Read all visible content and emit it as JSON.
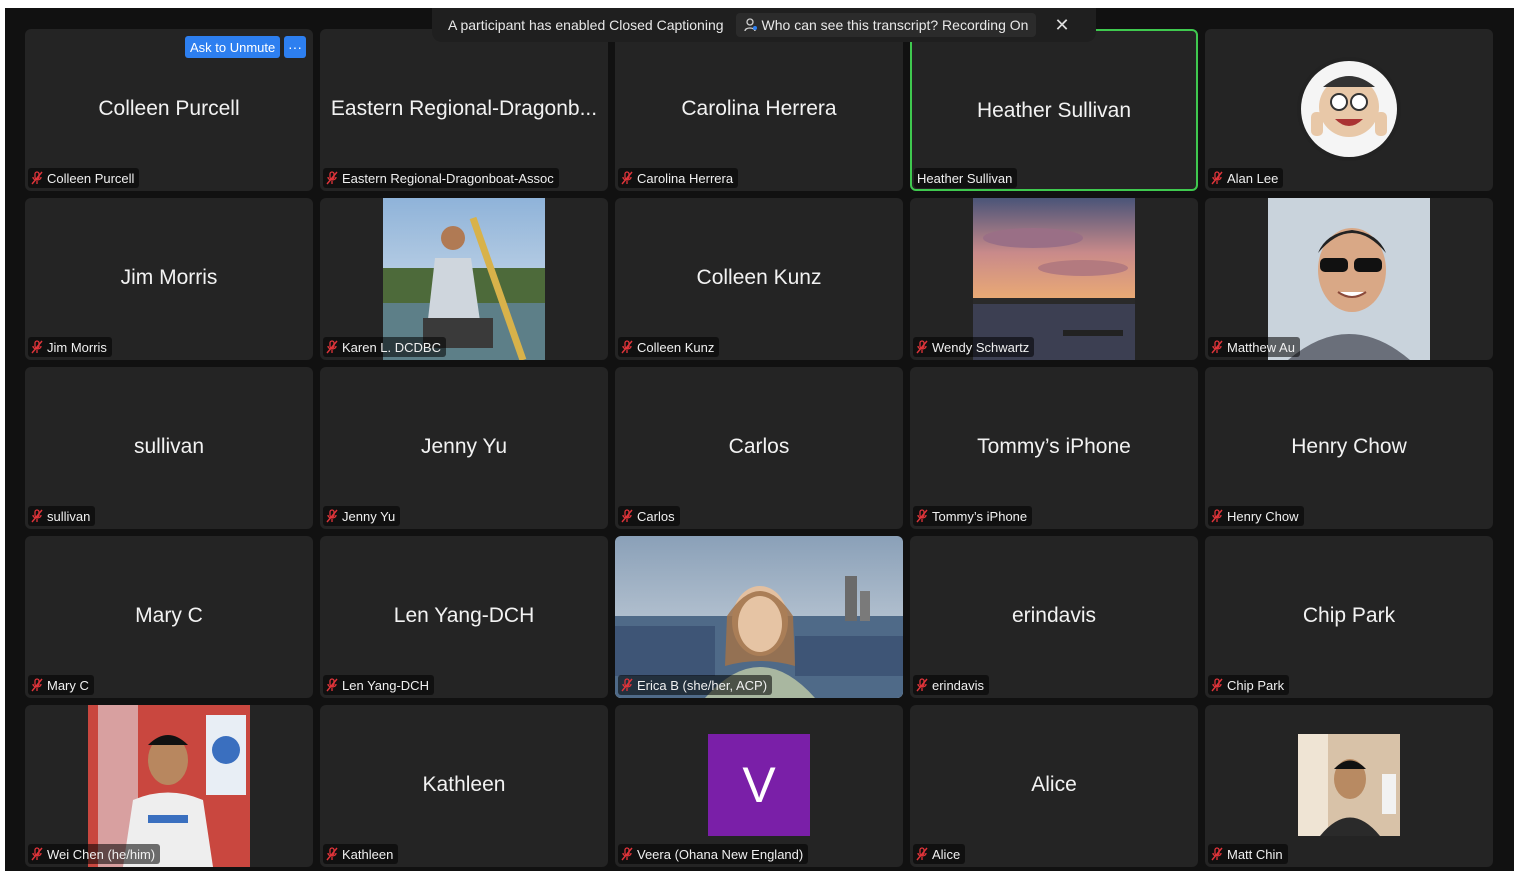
{
  "banner": {
    "cc_text": "A participant has enabled Closed Captioning",
    "who_text": "Who can see this transcript? Recording On",
    "close_label": "✕"
  },
  "host_controls": {
    "ask_unmute": "Ask to Unmute",
    "more": "···"
  },
  "participants": [
    {
      "display": "Colleen Purcell",
      "label": "Colleen Purcell",
      "video": "none"
    },
    {
      "display": "Eastern Regional-Dragonb...",
      "label": "Eastern Regional-Dragonboat-Assoc",
      "video": "none"
    },
    {
      "display": "Carolina Herrera",
      "label": "Carolina Herrera",
      "video": "none"
    },
    {
      "display": "Heather Sullivan",
      "label": "Heather Sullivan",
      "video": "none",
      "speaking": true
    },
    {
      "display": "",
      "label": "Alan Lee",
      "video": "avatar"
    },
    {
      "display": "Jim Morris",
      "label": "Jim Morris",
      "video": "none"
    },
    {
      "display": "",
      "label": "Karen  L. DCDBC",
      "video": "paddler-photo"
    },
    {
      "display": "Colleen Kunz",
      "label": "Colleen Kunz",
      "video": "none"
    },
    {
      "display": "",
      "label": "Wendy Schwartz",
      "video": "sunset-photo"
    },
    {
      "display": "",
      "label": "Matthew Au",
      "video": "portrait-photo"
    },
    {
      "display": "sullivan",
      "label": "sullivan",
      "video": "none"
    },
    {
      "display": "Jenny Yu",
      "label": "Jenny Yu",
      "video": "none"
    },
    {
      "display": "Carlos",
      "label": "Carlos",
      "video": "none"
    },
    {
      "display": "Tommy’s iPhone",
      "label": "Tommy’s iPhone",
      "video": "none"
    },
    {
      "display": "Henry Chow",
      "label": "Henry Chow",
      "video": "none"
    },
    {
      "display": "Mary C",
      "label": "Mary C",
      "video": "none"
    },
    {
      "display": "Len Yang-DCH",
      "label": "Len Yang-DCH",
      "video": "none"
    },
    {
      "display": "",
      "label": "Erica B (she/her, ACP)",
      "video": "live-video"
    },
    {
      "display": "erindavis",
      "label": "erindavis",
      "video": "none"
    },
    {
      "display": "Chip Park",
      "label": "Chip Park",
      "video": "none"
    },
    {
      "display": "",
      "label": "Wei Chen (he/him)",
      "video": "poster-photo"
    },
    {
      "display": "Kathleen",
      "label": "Kathleen",
      "video": "none"
    },
    {
      "display": "",
      "label": "Veera (Ohana New England)",
      "video": "letter-avatar",
      "initial": "V"
    },
    {
      "display": "Alice",
      "label": "Alice",
      "video": "none"
    },
    {
      "display": "",
      "label": "Matt Chin",
      "video": "room-photo"
    }
  ],
  "colors": {
    "background": "#111111",
    "tile": "#242424",
    "speaking_border": "#3fc94f",
    "host_button": "#2d7ff0",
    "muted_icon": "#e0343a",
    "letter_avatar": "#7a1fa8"
  },
  "icons": {
    "mute": "microphone-muted-icon",
    "who": "person-icon",
    "close": "close-icon"
  }
}
